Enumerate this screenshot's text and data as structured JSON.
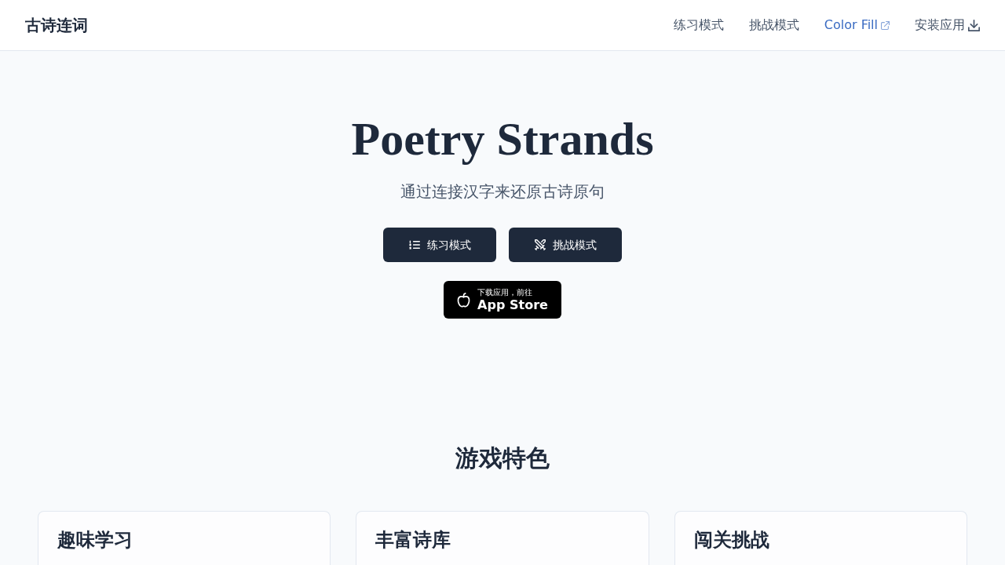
{
  "navbar": {
    "brand": "古诗连词",
    "links": [
      {
        "label": "练习模式",
        "kind": "plain"
      },
      {
        "label": "挑战模式",
        "kind": "plain"
      },
      {
        "label": "Color Fill",
        "kind": "external"
      },
      {
        "label": "安装应用",
        "kind": "install"
      }
    ]
  },
  "hero": {
    "title": "Poetry Strands",
    "subtitle": "通过连接汉字来还原古诗原句",
    "buttons": [
      {
        "label": "练习模式",
        "kind": "practice"
      },
      {
        "label": "挑战模式",
        "kind": "challenge"
      }
    ],
    "app_store": {
      "caption": "下载应用，前往",
      "label": "App Store"
    }
  },
  "features": {
    "heading": "游戏特色",
    "cards": [
      {
        "title": "趣味学习"
      },
      {
        "title": "丰富诗库"
      },
      {
        "title": "闯关挑战"
      }
    ]
  }
}
